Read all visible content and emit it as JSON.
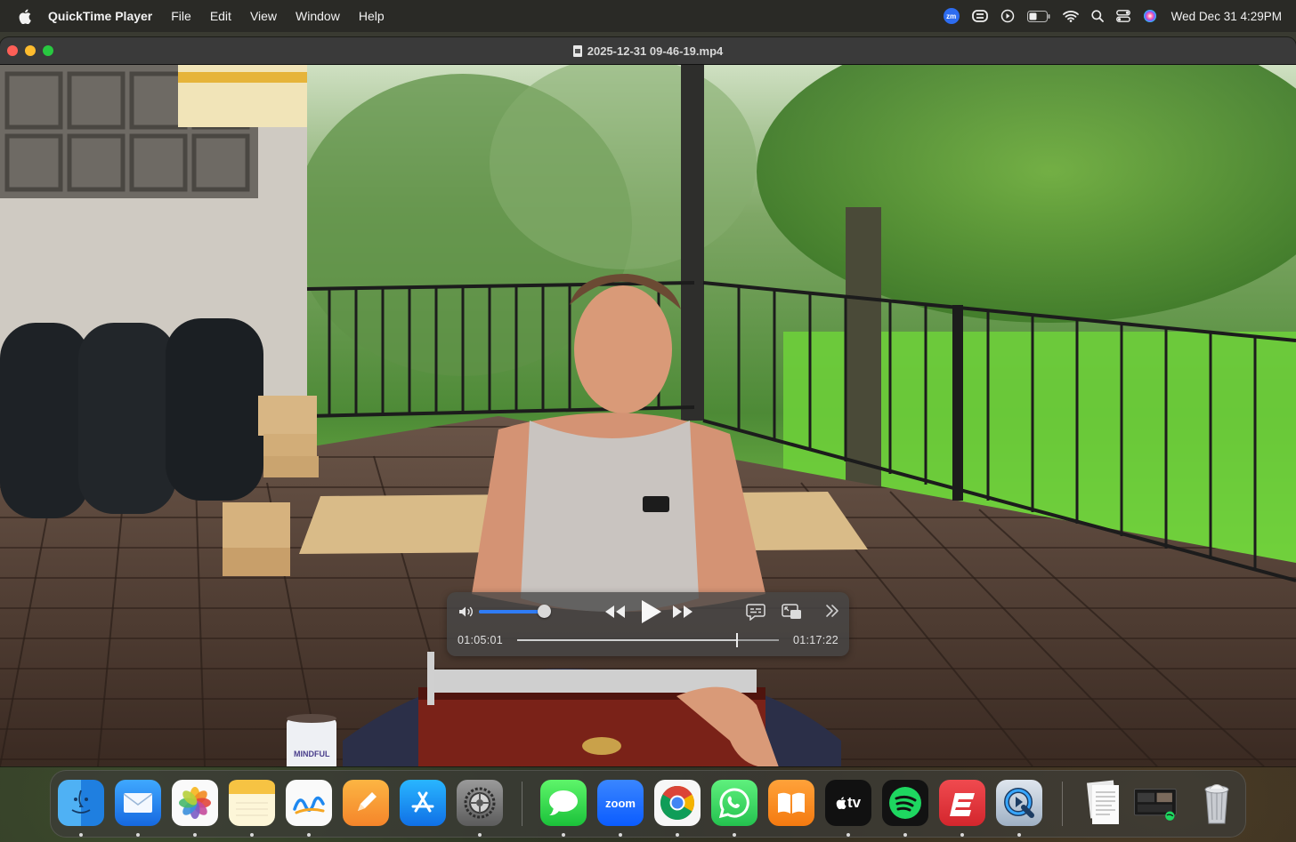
{
  "menubar": {
    "app_name": "QuickTime Player",
    "menus": [
      "File",
      "Edit",
      "View",
      "Window",
      "Help"
    ],
    "zoom_badge": "zm",
    "clock": "Wed Dec 31  4:29PM"
  },
  "window": {
    "title": "2025-12-31 09-46-19.mp4"
  },
  "player": {
    "elapsed": "01:05:01",
    "total": "01:17:22",
    "volume": 0.93,
    "progress": 0.84,
    "accent_color": "#2f7cf6"
  },
  "video_scene": {
    "mug_text": "MINDFUL"
  },
  "dock": {
    "apps": [
      "Finder",
      "Mail",
      "Photos",
      "Notes",
      "Freeform",
      "Pages",
      "App Store",
      "System Settings",
      "Messages",
      "Zoom",
      "Google Chrome",
      "WhatsApp",
      "Books",
      "TV",
      "Spotify",
      "Express VPN",
      "QuickTime Player"
    ],
    "zoom_label": "zoom",
    "tv_label": "tv"
  }
}
